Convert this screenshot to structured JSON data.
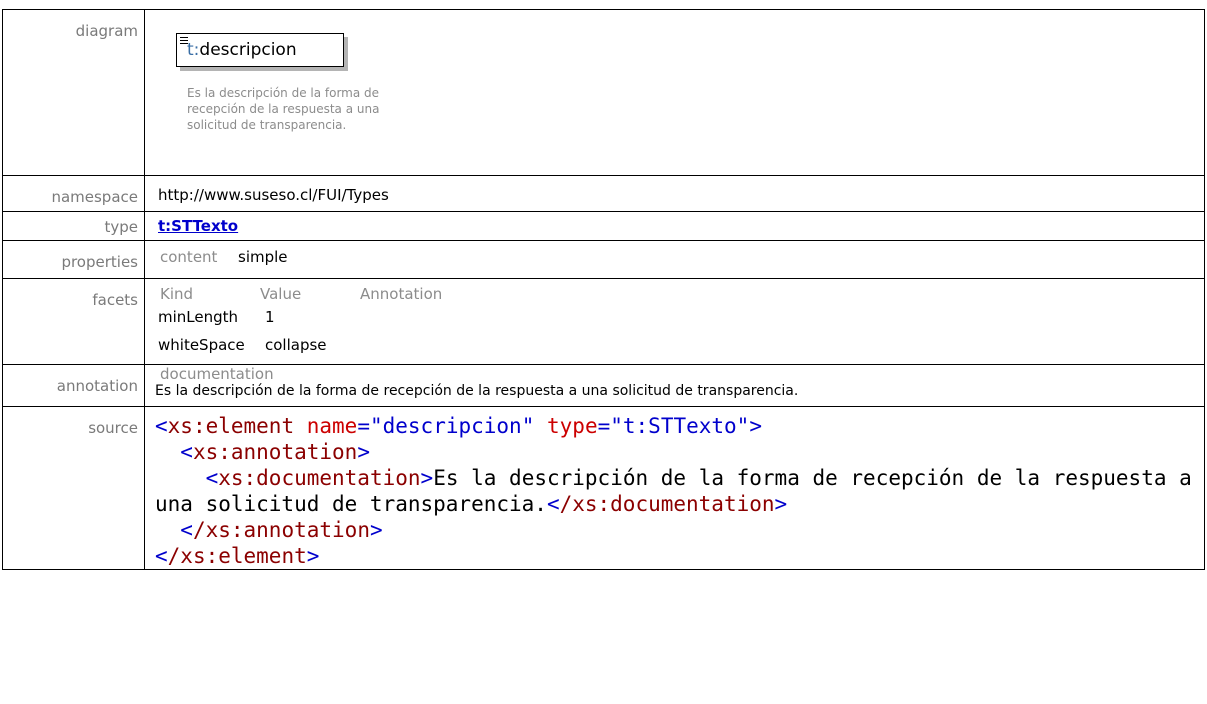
{
  "labels": {
    "diagram": "diagram",
    "namespace": "namespace",
    "type": "type",
    "properties": "properties",
    "facets": "facets",
    "annotation": "annotation",
    "source": "source"
  },
  "diagram": {
    "prefix": "t:",
    "name": "descripcion",
    "description": "Es la descripción de la forma de recepción de la respuesta a una solicitud de transparencia."
  },
  "namespace": "http://www.suseso.cl/FUI/Types",
  "type": "t:STTexto",
  "properties": {
    "key": "content",
    "value": "simple"
  },
  "facets": {
    "headers": [
      "Kind",
      "Value",
      "Annotation"
    ],
    "rows": [
      {
        "kind": "minLength",
        "value": "1"
      },
      {
        "kind": "whiteSpace",
        "value": "collapse"
      }
    ]
  },
  "annotation": {
    "header": "documentation",
    "text": "Es la descripción de la forma de recepción de la respuesta a una solicitud de transparencia."
  },
  "source": {
    "l1_tag": "xs:element",
    "l1_attr1": "name",
    "l1_val1": "\"descripcion\"",
    "l1_attr2": "type",
    "l1_val2": "\"t:STTexto\"",
    "l2_tag": "xs:annotation",
    "l3_tag": "xs:documentation",
    "l3_text": "Es la descripción de la forma de recepción de la respuesta a una solicitud de transparencia.",
    "l3_close": "/xs:documentation",
    "l4_close": "/xs:annotation",
    "l5_close": "/xs:element"
  },
  "colors": {
    "label_gray": "#7a7a7a",
    "link_blue": "#0000cc",
    "xml_tag": "#8b0000",
    "xml_attr": "#cc0000",
    "xml_bracket": "#0000cc"
  }
}
